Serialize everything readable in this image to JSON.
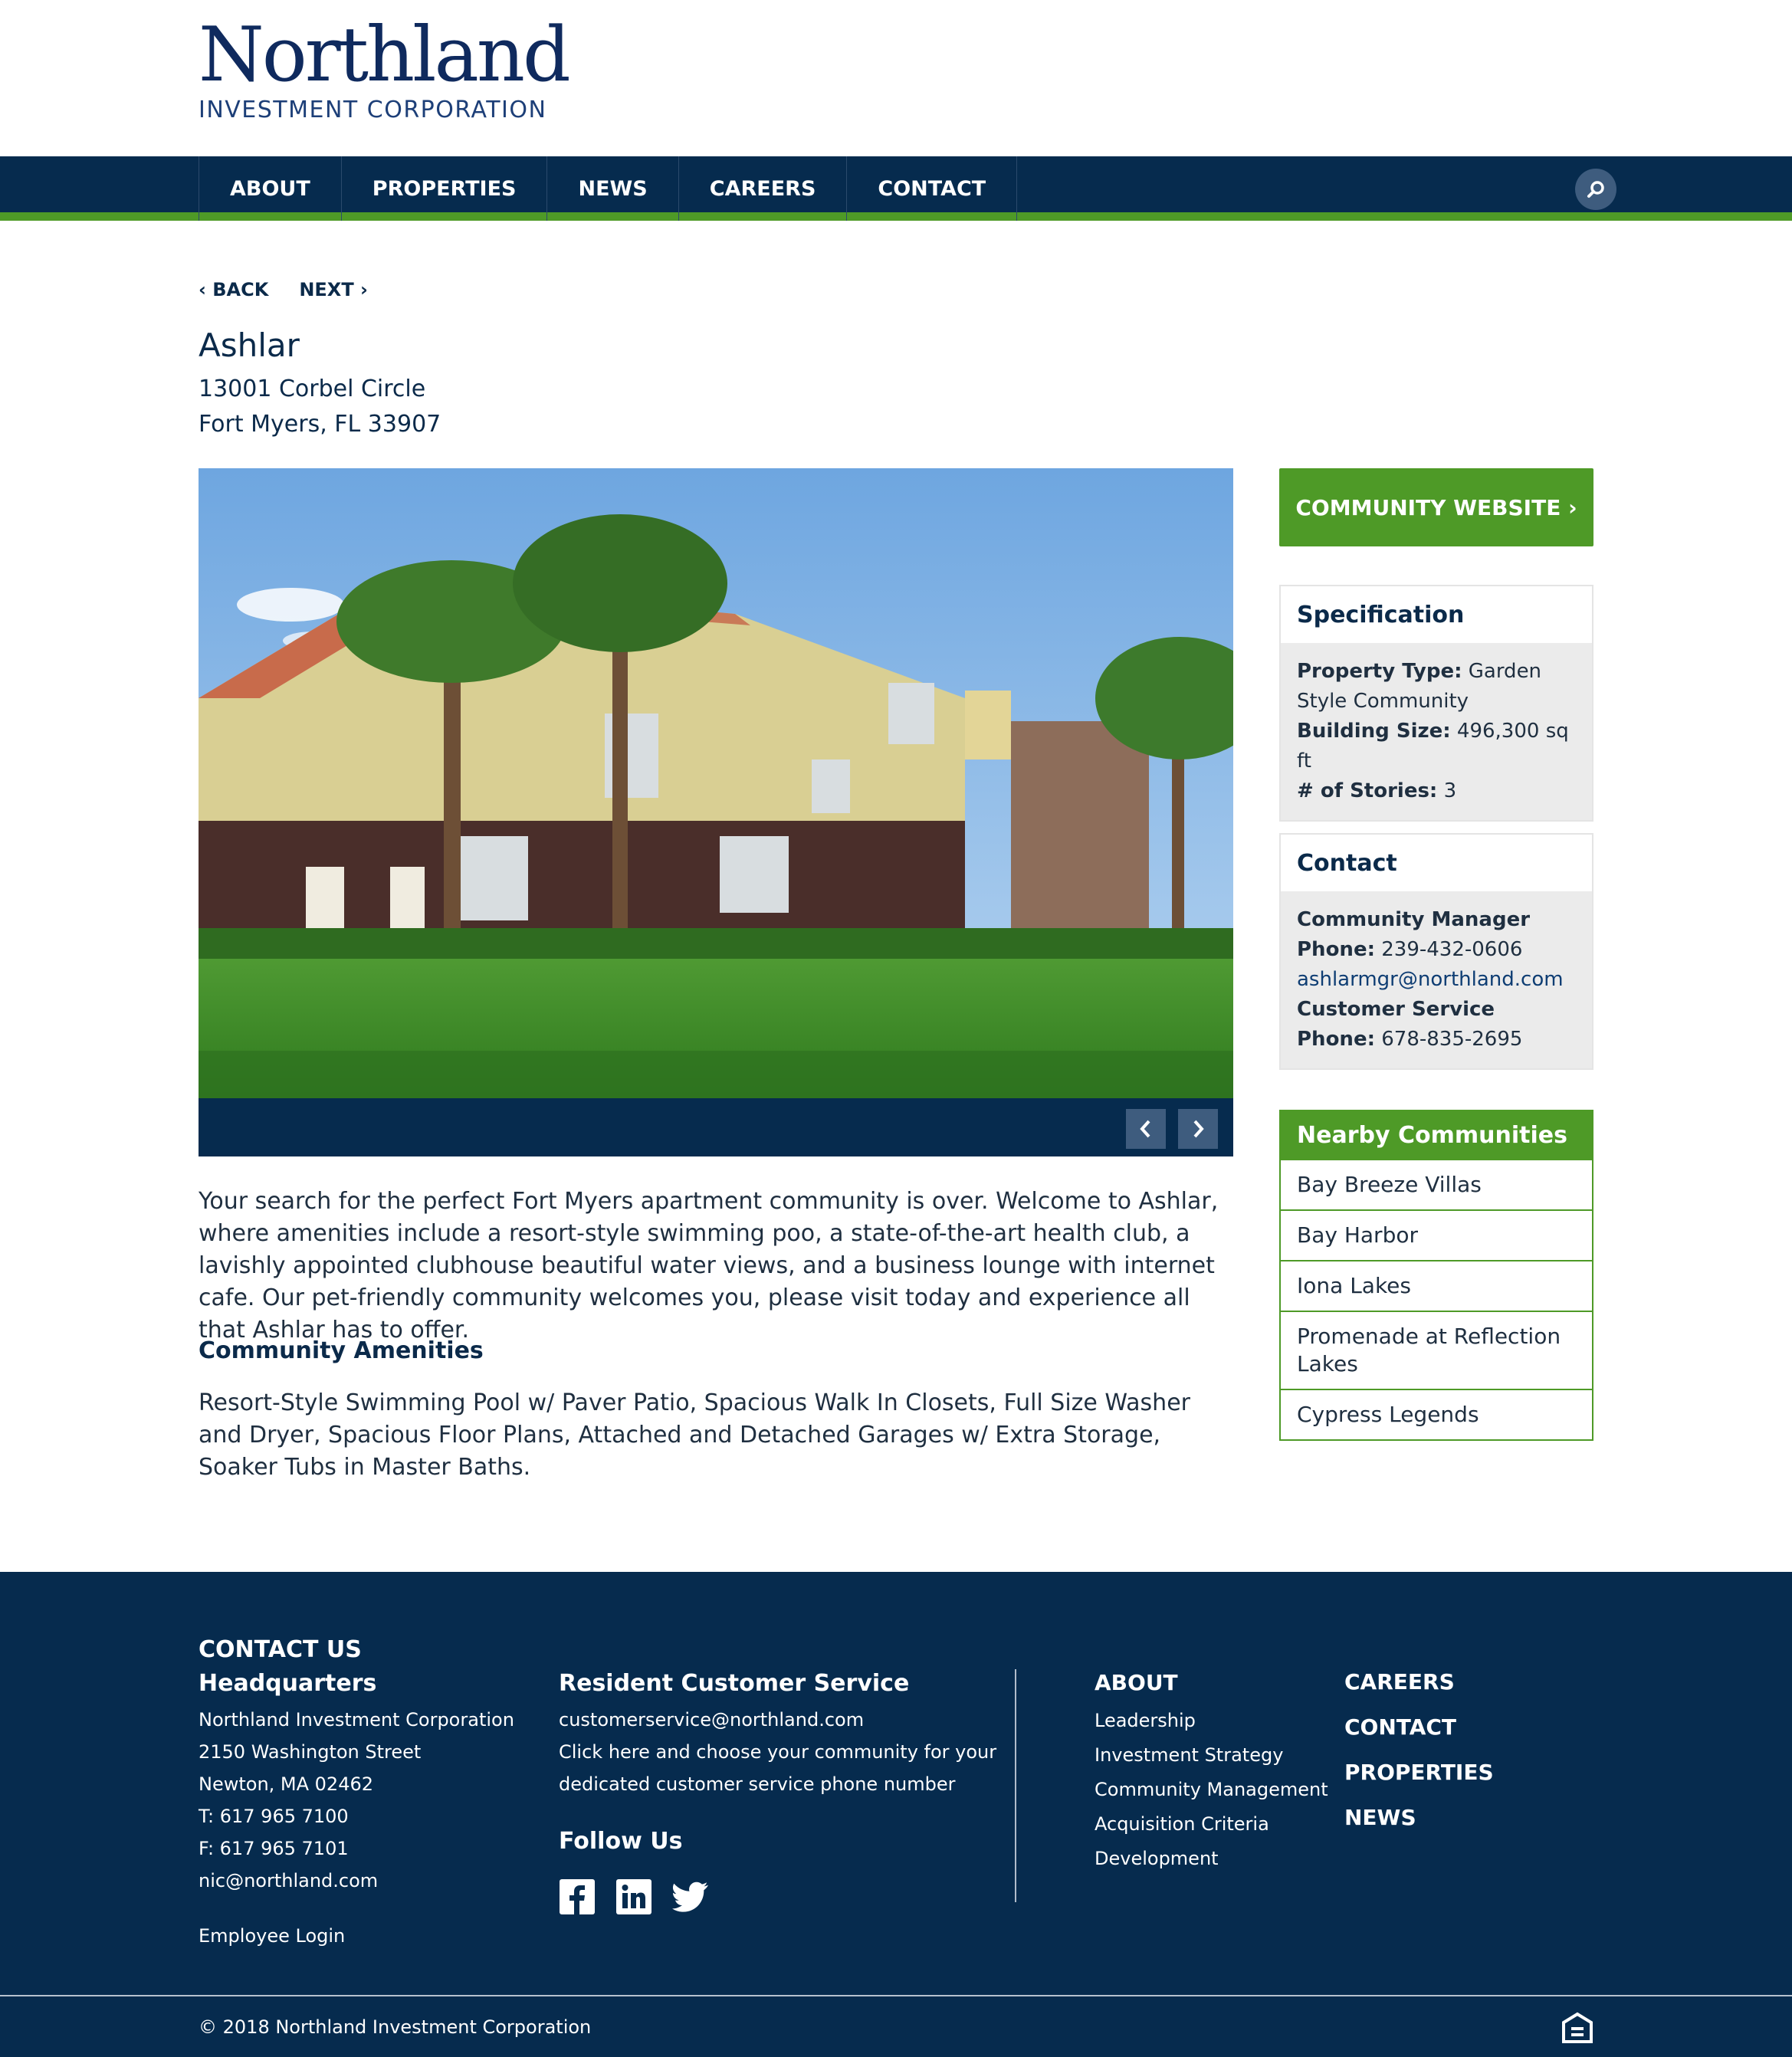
{
  "brand": {
    "name": "Northland",
    "subtitle": "INVESTMENT CORPORATION"
  },
  "nav": {
    "items": [
      {
        "label": "ABOUT"
      },
      {
        "label": "PROPERTIES"
      },
      {
        "label": "NEWS"
      },
      {
        "label": "CAREERS"
      },
      {
        "label": "CONTACT"
      }
    ]
  },
  "pager": {
    "back": "‹ BACK",
    "next": "NEXT ›"
  },
  "property": {
    "name": "Ashlar",
    "address_line1": "13001 Corbel Circle",
    "address_line2": "Fort Myers, FL 33907",
    "description": "Your search for the perfect Fort Myers apartment community is over. Welcome to Ashlar, where amenities include a resort-style swimming poo, a state-of-the-art health club, a lavishly appointed clubhouse beautiful water views, and a business lounge with internet cafe. Our pet-friendly community welcomes you, please visit today and experience all that Ashlar has to offer.",
    "amenities_heading": "Community Amenities",
    "amenities": "Resort-Style Swimming Pool w/ Paver Patio, Spacious Walk In Closets, Full Size Washer and Dryer, Spacious Floor Plans, Attached and Detached Garages w/ Extra Storage, Soaker Tubs in Master Baths."
  },
  "sidebar": {
    "community_website": "COMMUNITY WEBSITE ›",
    "specification": {
      "heading": "Specification",
      "property_type_label": "Property Type:",
      "property_type_value": " Garden Style Community",
      "building_size_label": "Building Size:",
      "building_size_value": " 496,300 sq ft",
      "stories_label": "# of Stories:",
      "stories_value": " 3"
    },
    "contact": {
      "heading": "Contact",
      "manager_label": "Community Manager",
      "manager_phone_label": "Phone:",
      "manager_phone": " 239-432-0606",
      "manager_email": "ashlarmgr@northland.com",
      "cs_label": "Customer Service",
      "cs_phone_label": "Phone:",
      "cs_phone": " 678-835-2695"
    },
    "nearby": {
      "heading": "Nearby Communities",
      "items": [
        "Bay Breeze Villas",
        "Bay Harbor",
        "Iona Lakes",
        "Promenade at Reflection Lakes",
        "Cypress Legends"
      ]
    }
  },
  "footer": {
    "contact_us": "CONTACT US",
    "hq_heading": "Headquarters",
    "hq_lines": [
      "Northland Investment Corporation",
      "2150 Washington Street",
      "Newton, MA 02462",
      "T: 617 965 7100",
      "F: 617 965 7101",
      "nic@northland.com"
    ],
    "employee_login": "Employee Login",
    "rcs_heading": "Resident Customer Service",
    "rcs_email": "customerservice@northland.com",
    "rcs_line1": "Click here and choose your community for your",
    "rcs_line2": "dedicated customer service phone number",
    "follow_heading": "Follow Us",
    "about_heading": "ABOUT",
    "about_links": [
      "Leadership",
      "Investment Strategy",
      "Community Management",
      "Acquisition Criteria",
      "Development"
    ],
    "right_links": [
      "CAREERS",
      "CONTACT",
      "PROPERTIES",
      "NEWS"
    ],
    "copyright": "© 2018 Northland Investment Corporation"
  },
  "icons": {
    "search": "search-icon",
    "prev": "chevron-left-icon",
    "next": "chevron-right-icon",
    "facebook": "facebook-icon",
    "linkedin": "linkedin-icon",
    "twitter": "twitter-icon",
    "equal_housing": "equal-housing-icon"
  },
  "colors": {
    "navy": "#062b4e",
    "green": "#4e9a27",
    "panel_gray": "#ebebeb"
  }
}
